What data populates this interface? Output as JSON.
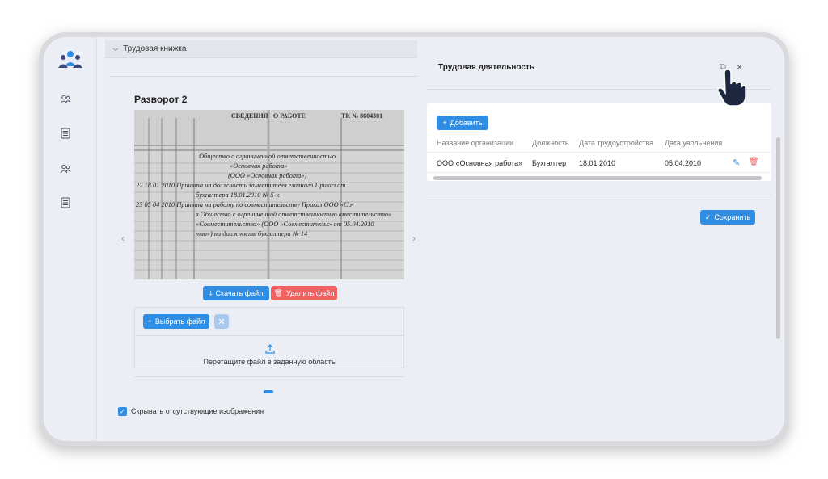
{
  "left_panel": {
    "header_label": "Трудовая книжка",
    "spread_title": "Разворот 2",
    "download_label": "Скачать файл",
    "delete_label": "Удалить файл",
    "choose_file_label": "Выбрать файл",
    "drop_text": "Перетащите файл в заданную область",
    "hide_missing_label": "Скрывать отсутствующие изображения",
    "document_photo": {
      "header_left": "СВЕДЕНИЯ",
      "header_mid": "О РАБОТЕ",
      "header_right": "ТК № 8604301",
      "lines": [
        "Общество с ограниченной ответственностью",
        "«Основная работа»",
        "(ООО «Основная работа»)",
        "22  18  01  2010 Принята на должность заместителя главного   Приказ от",
        "бухгалтера   18.01.2010 № 5-к",
        "23  05  04  2010 Принята на работу по совместительству   Приказ ООО «Со-",
        "в Общество с ограниченной ответственностью   вместительство»",
        "«Совместительство» (ООО «Совместительс-   от 05.04.2010",
        "тво») на должность бухгалтера   № 14"
      ]
    }
  },
  "right_panel": {
    "title": "Трудовая деятельность",
    "add_label": "Добавить",
    "save_label": "Сохранить",
    "columns": [
      "Название организации",
      "Должность",
      "Дата трудоустройства",
      "Дата увольнения"
    ],
    "rows": [
      {
        "org": "ООО «Основная работа»",
        "position": "Бухгалтер",
        "hire_date": "18.01.2010",
        "fire_date": "05.04.2010"
      }
    ]
  },
  "colors": {
    "accent": "#2f8de4",
    "danger": "#f06262"
  }
}
